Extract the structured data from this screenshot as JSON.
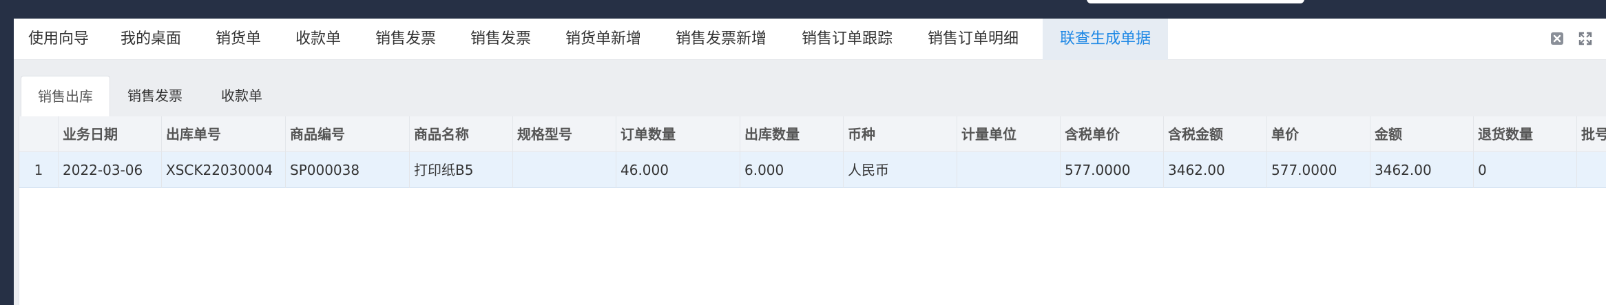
{
  "tabs": [
    {
      "label": "使用向导"
    },
    {
      "label": "我的桌面"
    },
    {
      "label": "销货单"
    },
    {
      "label": "收款单"
    },
    {
      "label": "销售发票"
    },
    {
      "label": "销售发票"
    },
    {
      "label": "销货单新增"
    },
    {
      "label": "销售发票新增"
    },
    {
      "label": "销售订单跟踪"
    },
    {
      "label": "销售订单明细"
    },
    {
      "label": "联查生成单据",
      "active": true
    }
  ],
  "window_icons": [
    "close-tab-icon",
    "fullscreen-icon"
  ],
  "subtabs": [
    {
      "label": "销售出库",
      "active": true
    },
    {
      "label": "销售发票"
    },
    {
      "label": "收款单"
    }
  ],
  "table": {
    "columns": [
      "业务日期",
      "出库单号",
      "商品编号",
      "商品名称",
      "规格型号",
      "订单数量",
      "出库数量",
      "币种",
      "计量单位",
      "含税单价",
      "含税金额",
      "单价",
      "金额",
      "退货数量",
      "批号"
    ],
    "rows": [
      {
        "index": "1",
        "cells": [
          "2022-03-06",
          "XSCK22030004",
          "SP000038",
          "打印纸B5",
          "",
          "46.000",
          "6.000",
          "人民币",
          "",
          "577.0000",
          "3462.00",
          "577.0000",
          "3462.00",
          "0",
          ""
        ]
      }
    ]
  },
  "colors": {
    "topbar": "#263045",
    "active_tab_bg": "#e6ecf3",
    "active_tab_text": "#1e88e5",
    "selected_row": "#e8f2fc"
  }
}
